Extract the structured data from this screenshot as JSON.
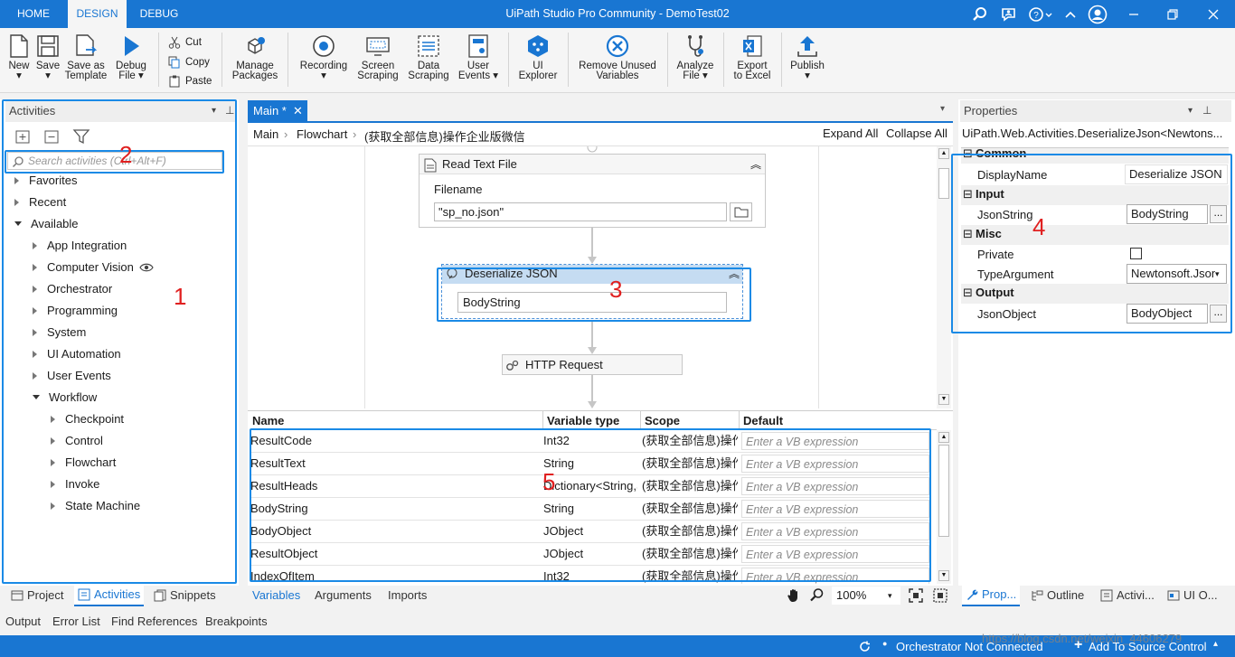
{
  "titlebar": {
    "tabs": [
      "HOME",
      "DESIGN",
      "DEBUG"
    ],
    "title": "UiPath Studio Pro Community - DemoTest02"
  },
  "ribbon": {
    "new": "New",
    "save": "Save",
    "save_as_template_1": "Save as",
    "save_as_template_2": "Template",
    "debug_file_1": "Debug",
    "debug_file_2": "File",
    "cut": "Cut",
    "copy": "Copy",
    "paste": "Paste",
    "manage_packages_1": "Manage",
    "manage_packages_2": "Packages",
    "recording": "Recording",
    "screen_scraping_1": "Screen",
    "screen_scraping_2": "Scraping",
    "data_scraping_1": "Data",
    "data_scraping_2": "Scraping",
    "user_events_1": "User",
    "user_events_2": "Events",
    "ui_explorer_1": "UI",
    "ui_explorer_2": "Explorer",
    "remove_unused_1": "Remove Unused",
    "remove_unused_2": "Variables",
    "analyze_file_1": "Analyze",
    "analyze_file_2": "File",
    "export_excel_1": "Export",
    "export_excel_2": "to Excel",
    "publish": "Publish"
  },
  "activities": {
    "title": "Activities",
    "search_placeholder": "Search activities (Ctrl+Alt+F)",
    "items": {
      "favorites": "Favorites",
      "recent": "Recent",
      "available": "Available",
      "app_integration": "App Integration",
      "computer_vision": "Computer Vision",
      "orchestrator": "Orchestrator",
      "programming": "Programming",
      "system": "System",
      "ui_automation": "UI Automation",
      "user_events": "User Events",
      "workflow": "Workflow",
      "checkpoint": "Checkpoint",
      "control": "Control",
      "flowchart": "Flowchart",
      "invoke": "Invoke",
      "state_machine": "State Machine"
    }
  },
  "designer": {
    "tab": "Main *",
    "breadcrumb": [
      "Main",
      "Flowchart",
      "(获取全部信息)操作企业版微信"
    ],
    "expand_all": "Expand All",
    "collapse_all": "Collapse All",
    "read_text_file": {
      "title": "Read Text File",
      "filename_label": "Filename",
      "filename_value": "\"sp_no.json\""
    },
    "deserialize": {
      "title": "Deserialize JSON",
      "value": "BodyString"
    },
    "http_request": "HTTP Request"
  },
  "variables": {
    "headers": [
      "Name",
      "Variable type",
      "Scope",
      "Default"
    ],
    "default_placeholder": "Enter a VB expression",
    "rows": [
      {
        "name": "ResultCode",
        "type": "Int32",
        "scope": "(获取全部信息)操作企"
      },
      {
        "name": "ResultText",
        "type": "String",
        "scope": "(获取全部信息)操作企"
      },
      {
        "name": "ResultHeads",
        "type": "Dictionary<String,String>",
        "scope": "(获取全部信息)操作企"
      },
      {
        "name": "BodyString",
        "type": "String",
        "scope": "(获取全部信息)操作企"
      },
      {
        "name": "BodyObject",
        "type": "JObject",
        "scope": "(获取全部信息)操作企"
      },
      {
        "name": "ResultObject",
        "type": "JObject",
        "scope": "(获取全部信息)操作企"
      },
      {
        "name": "IndexOfItem",
        "type": "Int32",
        "scope": "(获取全部信息)操作企"
      }
    ],
    "tabs": [
      "Variables",
      "Arguments",
      "Imports"
    ],
    "zoom": "100%"
  },
  "properties": {
    "title": "Properties",
    "type_name": "UiPath.Web.Activities.DeserializeJson<Newtons...",
    "categories": {
      "common": "Common",
      "input": "Input",
      "misc": "Misc",
      "output": "Output"
    },
    "rows": {
      "display_name_label": "DisplayName",
      "display_name_value": "Deserialize JSON",
      "json_string_label": "JsonString",
      "json_string_value": "BodyString",
      "private_label": "Private",
      "type_argument_label": "TypeArgument",
      "type_argument_value": "Newtonsoft.Json",
      "json_object_label": "JsonObject",
      "json_object_value": "BodyObject"
    }
  },
  "left_tabs": [
    "Project",
    "Activities",
    "Snippets"
  ],
  "right_tabs": [
    "Prop...",
    "Outline",
    "Activi...",
    "UI O..."
  ],
  "output_tabs": [
    "Output",
    "Error List",
    "Find References",
    "Breakpoints"
  ],
  "status": {
    "orchestrator": "Orchestrator Not Connected",
    "source_control": "Add To Source Control",
    "watermark": "https://blog.csdn.net/weixin_44606279"
  },
  "annotations": [
    "1",
    "2",
    "3",
    "4",
    "5"
  ],
  "colors": {
    "accent": "#1976d2",
    "highlight_box": "#1a8ae6",
    "annotation": "#e02020"
  }
}
